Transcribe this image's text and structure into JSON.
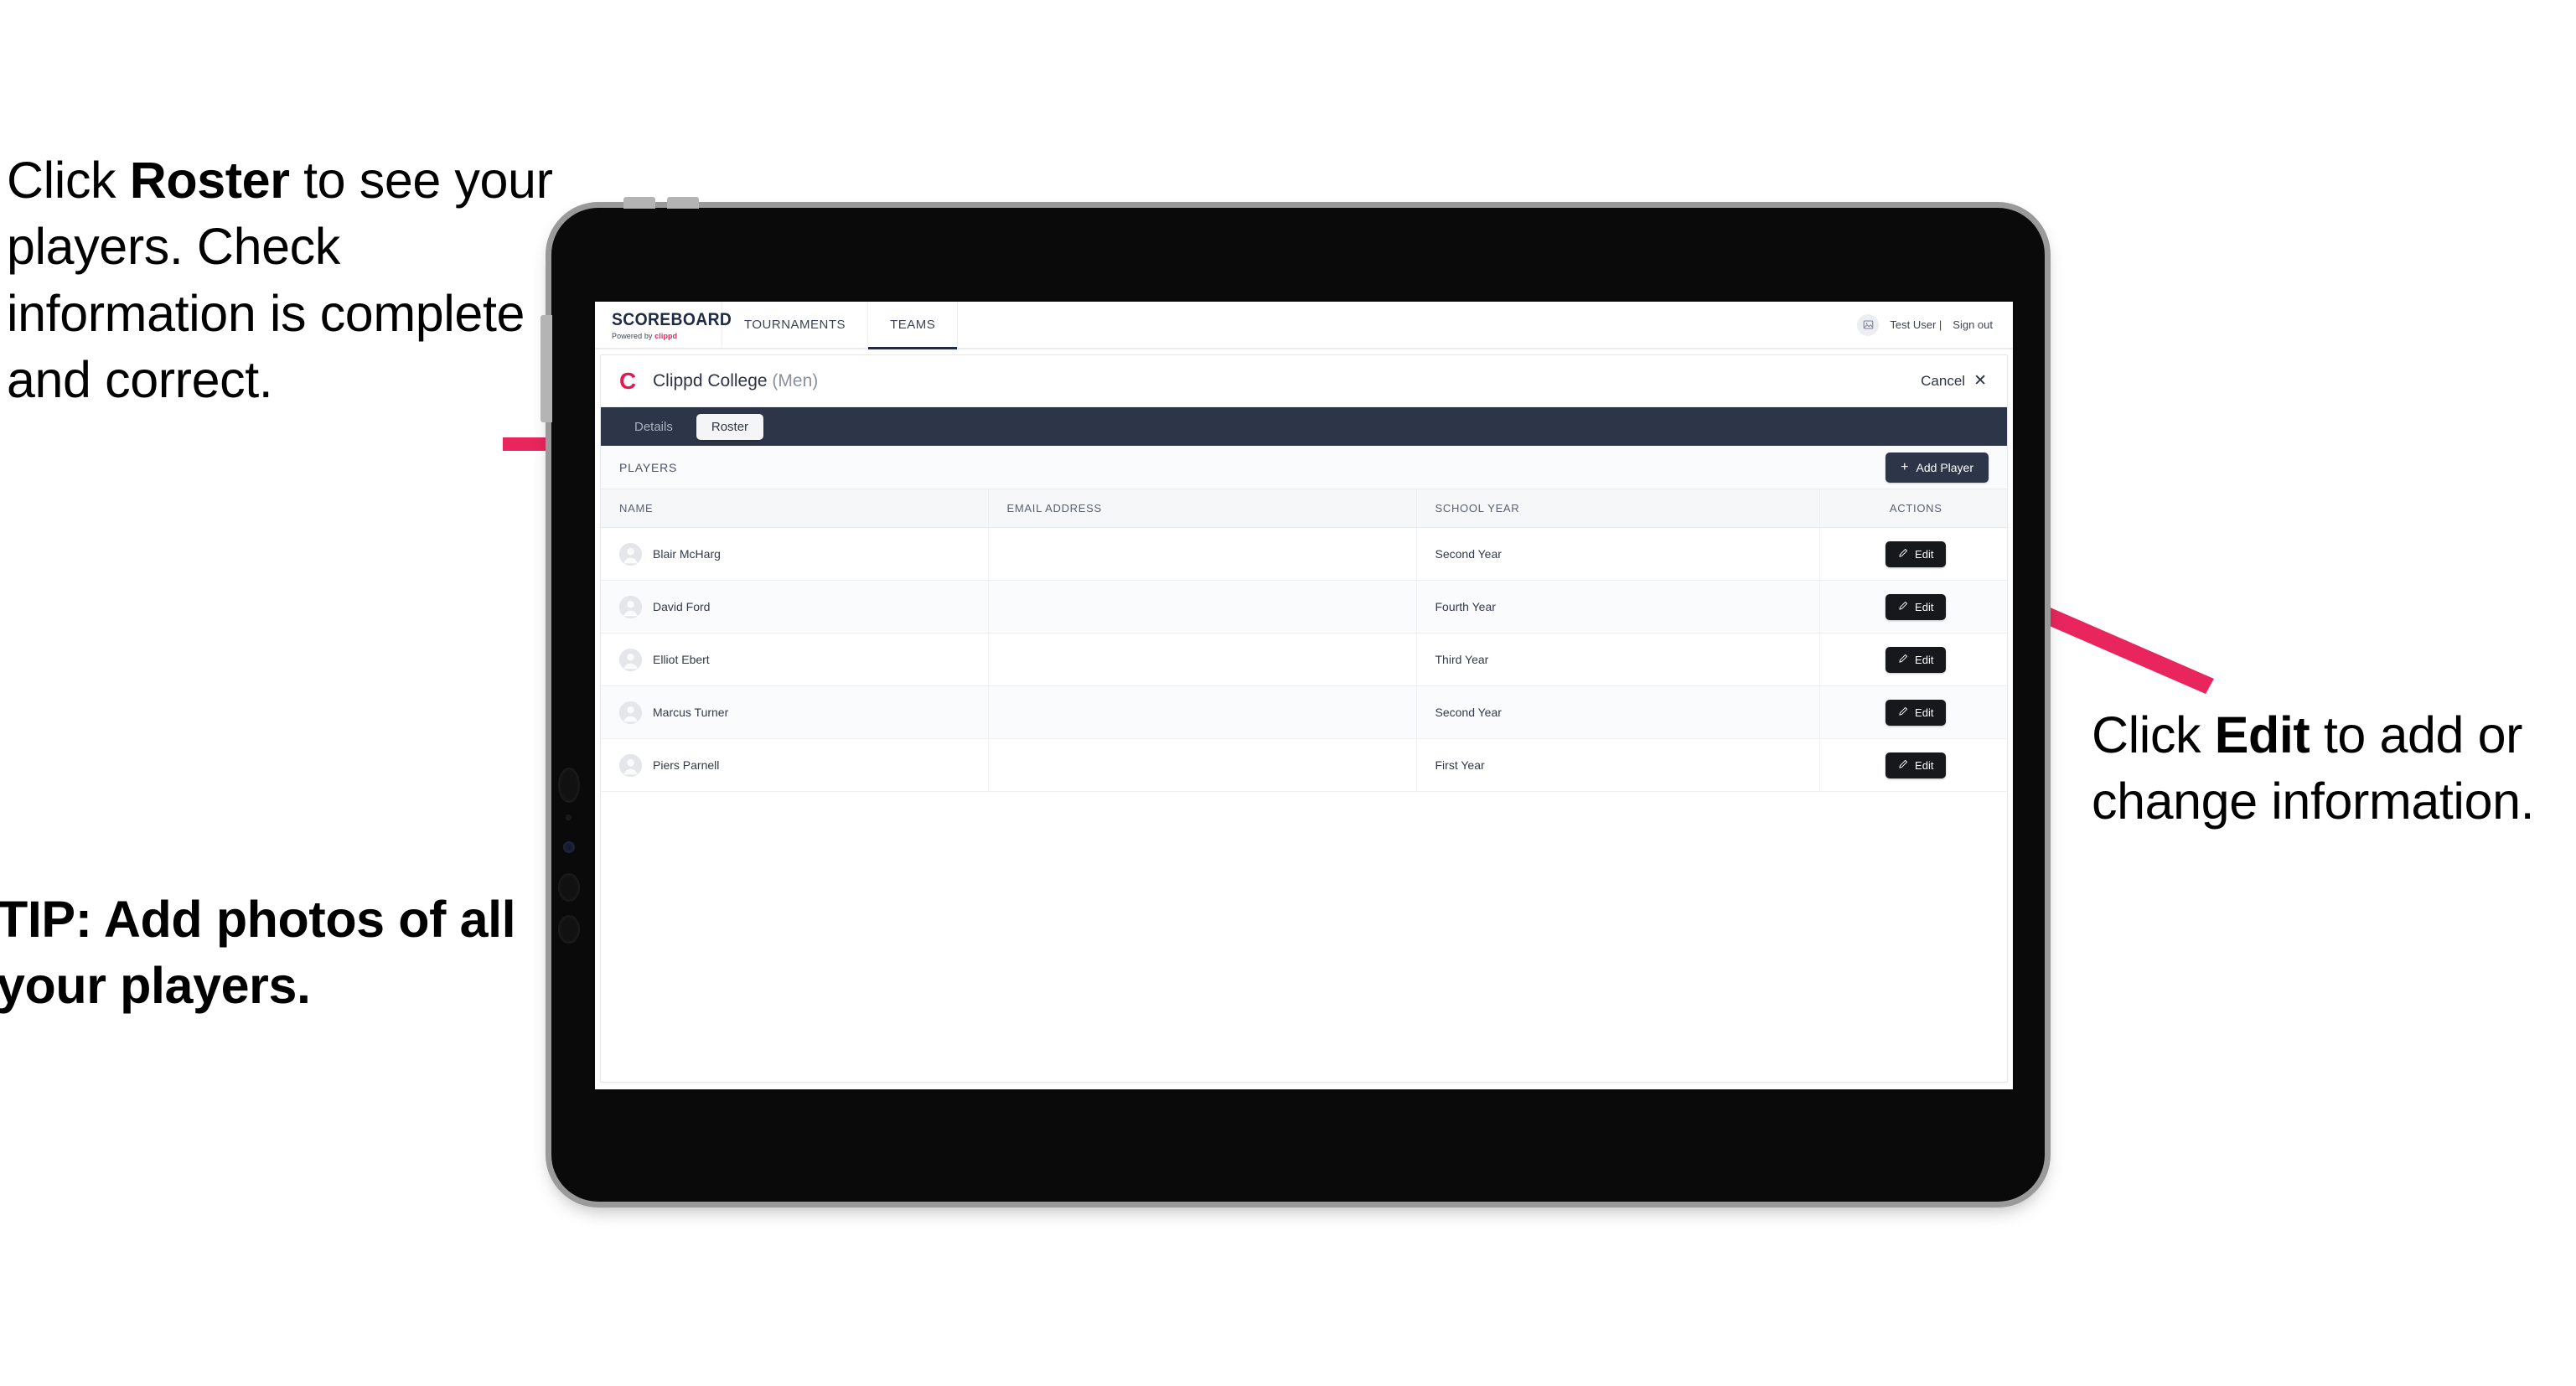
{
  "annotations": {
    "left": {
      "pre": "Click ",
      "bold": "Roster",
      "post": " to see your players. Check information is complete and correct."
    },
    "tip": "TIP: Add photos of all your players.",
    "right": {
      "pre": "Click ",
      "bold": "Edit",
      "post": " to add or change information."
    },
    "arrow_color": "#e8265d"
  },
  "app": {
    "brand": {
      "title": "SCOREBOARD",
      "powered_prefix": "Powered by ",
      "powered_brand": "clippd",
      "brand_color": "#e8265d"
    },
    "nav_tabs": [
      {
        "label": "TOURNAMENTS",
        "active": false
      },
      {
        "label": "TEAMS",
        "active": true
      }
    ],
    "user": {
      "avatar_icon": "user-avatar-icon",
      "name": "Test User |",
      "sign_out": "Sign out"
    },
    "team_header": {
      "logo_letter": "C",
      "logo_color": "#e11a52",
      "name": "Clippd College",
      "gender": " (Men)",
      "cancel_label": "Cancel",
      "cancel_icon": "close-icon"
    },
    "sub_tabs": [
      {
        "label": "Details",
        "active": false
      },
      {
        "label": "Roster",
        "active": true
      }
    ],
    "toolbar": {
      "section_label": "PLAYERS",
      "add_player_label": "Add Player",
      "add_player_icon": "plus-icon"
    },
    "table": {
      "columns": [
        "NAME",
        "EMAIL ADDRESS",
        "SCHOOL YEAR",
        "ACTIONS"
      ],
      "edit_label": "Edit",
      "edit_icon": "pencil-icon",
      "rows": [
        {
          "name": "Blair McHarg",
          "email": "",
          "school_year": "Second Year"
        },
        {
          "name": "David Ford",
          "email": "",
          "school_year": "Fourth Year"
        },
        {
          "name": "Elliot Ebert",
          "email": "",
          "school_year": "Third Year"
        },
        {
          "name": "Marcus Turner",
          "email": "",
          "school_year": "Second Year"
        },
        {
          "name": "Piers Parnell",
          "email": "",
          "school_year": "First Year"
        }
      ]
    }
  }
}
